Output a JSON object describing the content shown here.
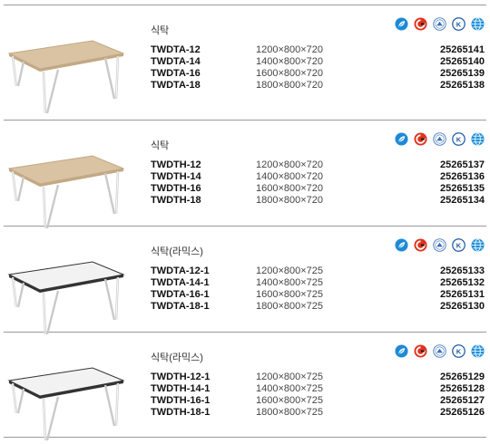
{
  "sections": [
    {
      "category": "식탁",
      "top_color": "#d9c3a2",
      "edge_color": "#c3a884",
      "rows": [
        {
          "model": "TWDTA-12",
          "size": "1200×800×720",
          "code": "25265141"
        },
        {
          "model": "TWDTA-14",
          "size": "1400×800×720",
          "code": "25265140"
        },
        {
          "model": "TWDTA-16",
          "size": "1600×800×720",
          "code": "25265139"
        },
        {
          "model": "TWDTA-18",
          "size": "1800×800×720",
          "code": "25265138"
        }
      ]
    },
    {
      "category": "식탁",
      "top_color": "#d9c3a2",
      "edge_color": "#c3a884",
      "rows": [
        {
          "model": "TWDTH-12",
          "size": "1200×800×720",
          "code": "25265137"
        },
        {
          "model": "TWDTH-14",
          "size": "1400×800×720",
          "code": "25265136"
        },
        {
          "model": "TWDTH-16",
          "size": "1600×800×720",
          "code": "25265135"
        },
        {
          "model": "TWDTH-18",
          "size": "1800×800×720",
          "code": "25265134"
        }
      ]
    },
    {
      "category": "식탁(라믹스)",
      "top_color": "#f2f2f2",
      "edge_color": "#333333",
      "rows": [
        {
          "model": "TWDTA-12-1",
          "size": "1200×800×725",
          "code": "25265133"
        },
        {
          "model": "TWDTA-14-1",
          "size": "1400×800×725",
          "code": "25265132"
        },
        {
          "model": "TWDTA-16-1",
          "size": "1600×800×725",
          "code": "25265131"
        },
        {
          "model": "TWDTA-18-1",
          "size": "1800×800×725",
          "code": "25265130"
        }
      ]
    },
    {
      "category": "식탁(라믹스)",
      "top_color": "#f2f2f2",
      "edge_color": "#333333",
      "rows": [
        {
          "model": "TWDTH-12-1",
          "size": "1200×800×725",
          "code": "25265129"
        },
        {
          "model": "TWDTH-14-1",
          "size": "1400×800×725",
          "code": "25265128"
        },
        {
          "model": "TWDTH-16-1",
          "size": "1600×800×725",
          "code": "25265127"
        },
        {
          "model": "TWDTH-18-1",
          "size": "1800×800×725",
          "code": "25265126"
        }
      ]
    }
  ],
  "cert_icons": [
    "eco-leaf-icon",
    "quality-mark-icon",
    "environment-mark-icon",
    "kc-mark-icon",
    "globe-icon"
  ],
  "colors": {
    "eco_blue": "#1e8ad6",
    "quality_red": "#e0331c",
    "kc_blue": "#1c5aa8",
    "globe_blue": "#1e90d8"
  }
}
